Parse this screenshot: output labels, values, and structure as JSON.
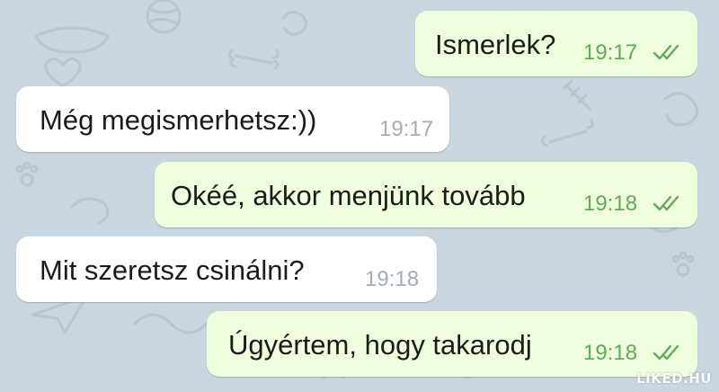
{
  "colors": {
    "background": "#c9d6e0",
    "outgoing_bubble": "#effedd",
    "incoming_bubble": "#ffffff",
    "outgoing_time": "#62a95a",
    "incoming_time": "#a3adb6",
    "read_ticks": "#62a95a"
  },
  "messages": [
    {
      "direction": "outgoing",
      "text": "Ismerlek?",
      "time": "19:17",
      "status_icon": "double-check-icon"
    },
    {
      "direction": "incoming",
      "text": "Még megismerhetsz:))",
      "time": "19:17"
    },
    {
      "direction": "outgoing",
      "text": "Okéé, akkor menjünk tovább",
      "time": "19:18",
      "status_icon": "double-check-icon"
    },
    {
      "direction": "incoming",
      "text": "Mit szeretsz csinálni?",
      "time": "19:18"
    },
    {
      "direction": "outgoing",
      "text": "Úgyértem, hogy takarodj",
      "time": "19:18",
      "status_icon": "double-check-icon"
    }
  ],
  "watermark": "LIKED.HU"
}
